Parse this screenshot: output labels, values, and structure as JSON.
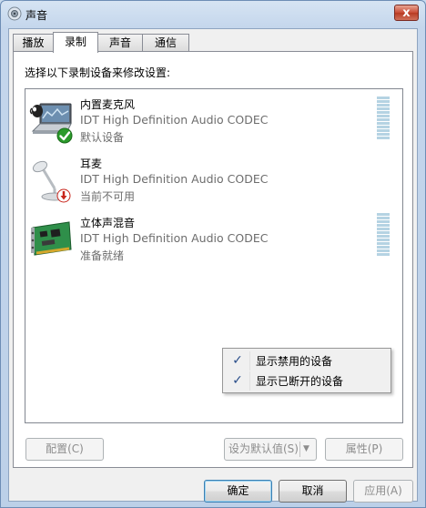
{
  "window": {
    "title": "声音",
    "close_label": "x"
  },
  "tabs": [
    {
      "label": "播放"
    },
    {
      "label": "录制"
    },
    {
      "label": "声音"
    },
    {
      "label": "通信"
    }
  ],
  "active_tab": "录制",
  "instruction": "选择以下录制设备来修改设置:",
  "devices": [
    {
      "name": "内置麦克风",
      "driver": "IDT High Definition Audio CODEC",
      "status": "默认设备",
      "icon": "laptop-microphone-icon",
      "badge": "default-check-badge"
    },
    {
      "name": "耳麦",
      "driver": "IDT High Definition Audio CODEC",
      "status": "当前不可用",
      "icon": "desk-microphone-icon",
      "badge": "unavailable-arrow-badge"
    },
    {
      "name": "立体声混音",
      "driver": "IDT High Definition Audio CODEC",
      "status": "准备就绪",
      "icon": "sound-card-icon",
      "badge": ""
    }
  ],
  "context_menu": {
    "items": [
      {
        "label": "显示禁用的设备",
        "checked": true
      },
      {
        "label": "显示已断开的设备",
        "checked": true
      }
    ]
  },
  "panel_buttons": {
    "configure": "配置(C)",
    "set_default": "设为默认值(S)",
    "properties": "属性(P)"
  },
  "dialog_buttons": {
    "ok": "确定",
    "cancel": "取消",
    "apply": "应用(A)"
  },
  "colors": {
    "check_green": "#2a9a2a",
    "badge_red": "#c8251b",
    "meter_cell": "#b5d3e3"
  }
}
